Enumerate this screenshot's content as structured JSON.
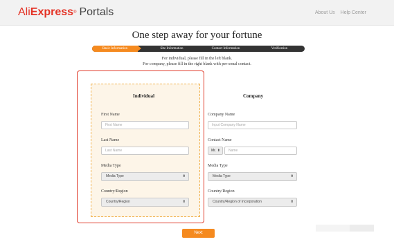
{
  "header": {
    "logo_ali": "Ali",
    "logo_express": "Express",
    "logo_portals": "Portals",
    "links": [
      "About Us",
      "Help Center"
    ]
  },
  "page": {
    "title": "One step away for your fortune",
    "instructions": [
      "For individual, please fill in the left blank.",
      "For company, please fill in the right blank with per-sonal contact."
    ]
  },
  "steps": [
    {
      "label": "Basic Information",
      "active": true
    },
    {
      "label": "Site Information",
      "active": false
    },
    {
      "label": "Contact Information",
      "active": false
    },
    {
      "label": "Verification",
      "active": false
    }
  ],
  "individual": {
    "title": "Individual",
    "first_name_label": "First Name",
    "first_name_placeholder": "First Name",
    "last_name_label": "Last Name",
    "last_name_placeholder": "Last Name",
    "media_type_label": "Media Type",
    "media_type_value": "Media Type",
    "country_label": "Country/Region",
    "country_value": "Country/Region"
  },
  "company": {
    "title": "Company",
    "company_name_label": "Company Name",
    "company_name_placeholder": "Input Company Name",
    "contact_name_label": "Contact Name",
    "salutation_value": "Mr.",
    "contact_name_placeholder": "Name",
    "media_type_label": "Media Type",
    "media_type_value": "Media Type",
    "country_label": "Country/Region",
    "country_value": "Country/Region of Incorporation"
  },
  "actions": {
    "next_label": "Next"
  },
  "colors": {
    "brand": "#e43225",
    "accent": "#f58a1f",
    "step_bar": "#333333",
    "highlight_border": "#e03b2a",
    "dashed_border": "#f1b14c",
    "panel_bg": "#fdf5e8"
  }
}
